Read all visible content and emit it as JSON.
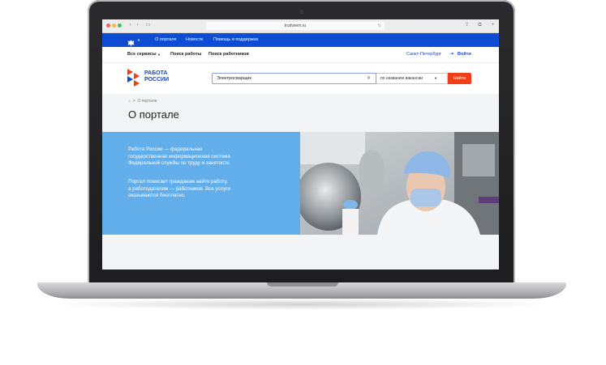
{
  "browser": {
    "url": "trudvsem.ru"
  },
  "govbar": {
    "links": [
      "О портале",
      "Новости",
      "Помощь и поддержка"
    ]
  },
  "nav": {
    "all_services": "Все сервисы",
    "find_job": "Поиск работы",
    "find_workers": "Поиск работников",
    "city": "Санкт-Петербург",
    "login": "Войти"
  },
  "logo": {
    "line1": "РАБОТА",
    "line2": "РОССИИ"
  },
  "search": {
    "value": "Электросварщик",
    "mode": "по названию вакансии",
    "button": "Найти"
  },
  "breadcrumb": {
    "current": "О портале"
  },
  "page": {
    "title": "О портале",
    "para1_l1": "Работа России — федеральная",
    "para1_l2": "государственная информационная система",
    "para1_l3": "Федеральной службы по труду и занятости.",
    "para2_l1": "Портал помогает гражданам найти работу,",
    "para2_l2": "а работодателям — работников. Все услуги",
    "para2_l3": "оказываются бесплатно."
  },
  "colors": {
    "gov_blue": "#0d4cd3",
    "accent_red": "#ee3f18",
    "panel_blue": "#62aeea"
  }
}
